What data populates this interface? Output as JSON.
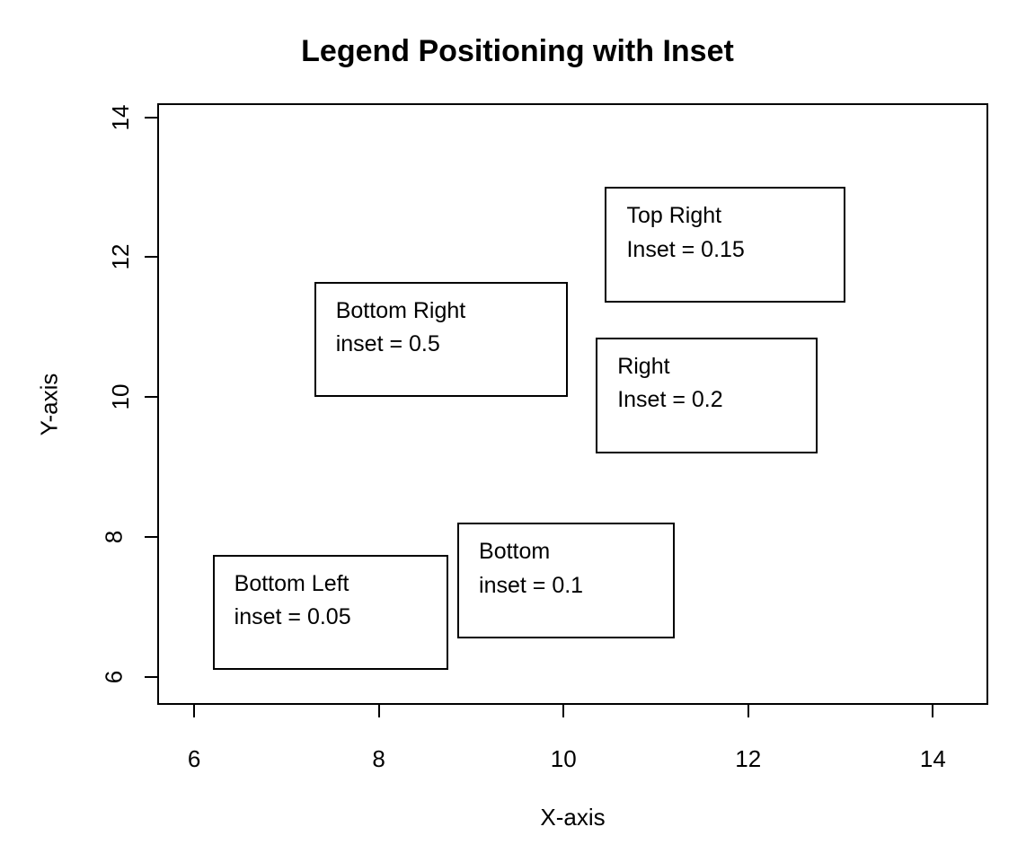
{
  "chart_data": {
    "type": "scatter",
    "title": "Legend Positioning with Inset",
    "xlabel": "X-axis",
    "ylabel": "Y-axis",
    "xlim": [
      5.6,
      14.6
    ],
    "ylim": [
      5.6,
      14.2
    ],
    "xticks": [
      6,
      8,
      10,
      12,
      14
    ],
    "yticks": [
      6,
      8,
      10,
      12,
      14
    ],
    "series": [],
    "annotations": [
      {
        "label1": "Top Right",
        "label2": "Inset = 0.15",
        "box_x": [
          10.45,
          13.05
        ],
        "box_y": [
          11.35,
          13.0
        ]
      },
      {
        "label1": "Bottom Right",
        "label2": "inset = 0.5",
        "box_x": [
          7.3,
          10.05
        ],
        "box_y": [
          10.0,
          11.65
        ]
      },
      {
        "label1": "Right",
        "label2": "Inset = 0.2",
        "box_x": [
          10.35,
          12.75
        ],
        "box_y": [
          9.2,
          10.85
        ]
      },
      {
        "label1": "Bottom Left",
        "label2": "inset = 0.05",
        "box_x": [
          6.2,
          8.75
        ],
        "box_y": [
          6.1,
          7.75
        ]
      },
      {
        "label1": "Bottom",
        "label2": "inset = 0.1",
        "box_x": [
          8.85,
          11.2
        ],
        "box_y": [
          6.55,
          8.2
        ]
      }
    ]
  }
}
